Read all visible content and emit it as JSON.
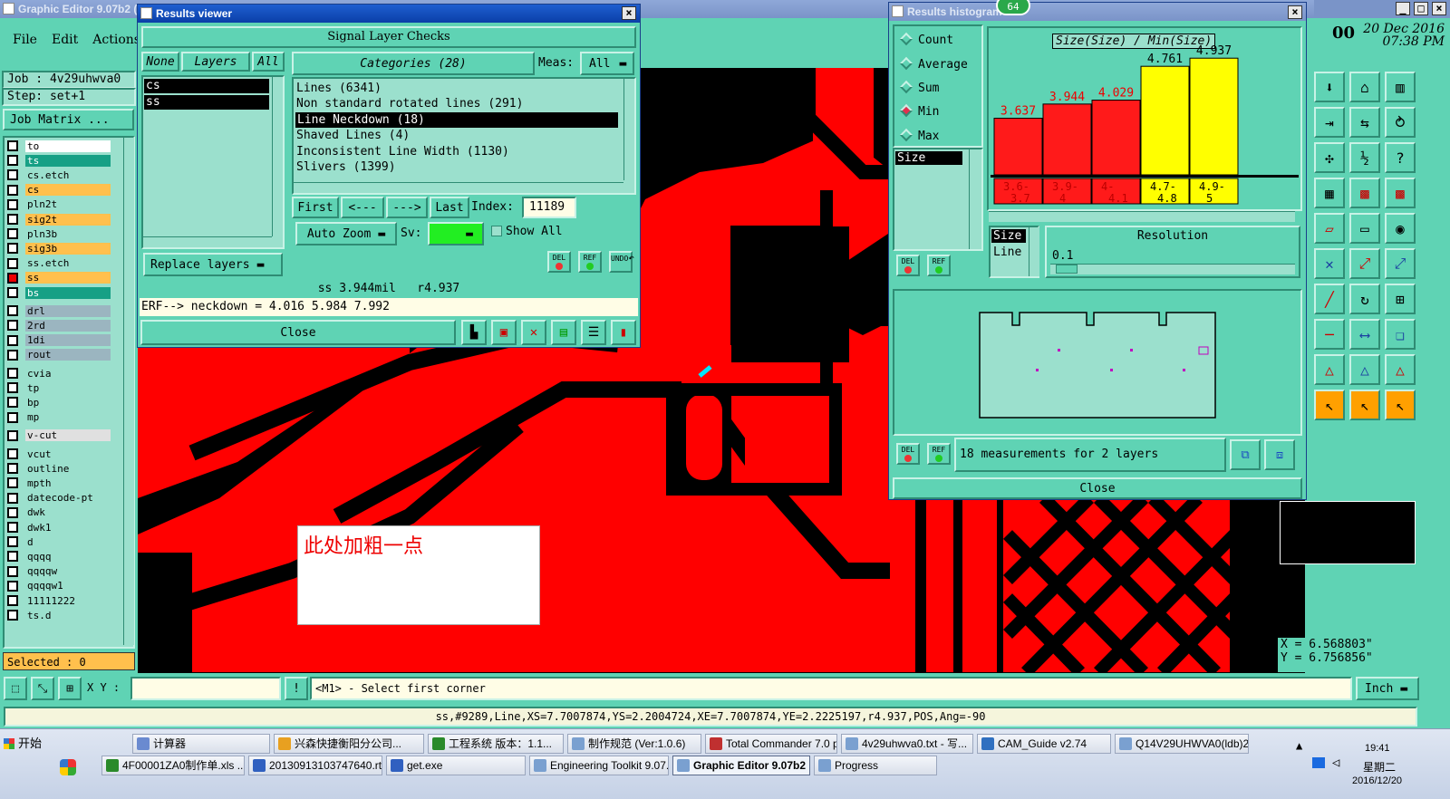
{
  "app": {
    "title": "Graphic Editor 9.07b2 (",
    "menu": [
      "File",
      "Edit",
      "Actions"
    ],
    "job_label": "Job : 4v29uhwva0",
    "step_label": "Step: set+1",
    "job_matrix_btn": "Job Matrix ...",
    "date": "20 Dec 2016",
    "time": "07:38 PM",
    "date_prefix": "00",
    "selected": "Selected : 0",
    "coord_x": "X = 6.568803\"",
    "coord_y": "Y = 6.756856\"",
    "xy_label": "X Y :",
    "prompt": "<M1> - Select first corner",
    "units": "Inch",
    "status_line": "ss,#9289,Line,XS=7.7007874,YS=2.2004724,XE=7.7007874,YE=2.2225197,r4.937,POS,Ang=-90",
    "annotation": "此处加粗一点",
    "badge": "64"
  },
  "layers": [
    {
      "name": "to",
      "color": "#ffffff"
    },
    {
      "name": "ts",
      "color": "#16a085"
    },
    {
      "name": "cs.etch",
      "color": "#9be0cd"
    },
    {
      "name": "cs",
      "color": "#ffc04d"
    },
    {
      "name": "pln2t",
      "color": "#9be0cd"
    },
    {
      "name": "sig2t",
      "color": "#ffc04d"
    },
    {
      "name": "pln3b",
      "color": "#9be0cd"
    },
    {
      "name": "sig3b",
      "color": "#ffc04d"
    },
    {
      "name": "ss.etch",
      "color": "#9be0cd"
    },
    {
      "name": "ss",
      "color": "#ffc04d"
    },
    {
      "name": "bs",
      "color": "#16a085"
    },
    {
      "name": "drl",
      "color": "#9bb5c0"
    },
    {
      "name": "2rd",
      "color": "#9bb5c0"
    },
    {
      "name": "1di",
      "color": "#9bb5c0"
    },
    {
      "name": "rout",
      "color": "#9bb5c0"
    },
    {
      "name": "cvia",
      "color": "#9be0cd"
    },
    {
      "name": "tp",
      "color": "#9be0cd"
    },
    {
      "name": "bp",
      "color": "#9be0cd"
    },
    {
      "name": "mp",
      "color": "#9be0cd"
    },
    {
      "name": "v-cut",
      "color": "#e0e0e0"
    },
    {
      "name": "vcut",
      "color": "#9be0cd"
    },
    {
      "name": "outline",
      "color": "#9be0cd"
    },
    {
      "name": "mpth",
      "color": "#9be0cd"
    },
    {
      "name": "datecode-pt",
      "color": "#9be0cd"
    },
    {
      "name": "dwk",
      "color": "#9be0cd"
    },
    {
      "name": "dwk1",
      "color": "#9be0cd"
    },
    {
      "name": "d",
      "color": "#9be0cd"
    },
    {
      "name": "qqqq",
      "color": "#9be0cd"
    },
    {
      "name": "qqqqw",
      "color": "#9be0cd"
    },
    {
      "name": "qqqqw1",
      "color": "#9be0cd"
    },
    {
      "name": "11111222",
      "color": "#9be0cd"
    },
    {
      "name": "ts.d",
      "color": "#9be0cd"
    }
  ],
  "results_viewer": {
    "title": "Results viewer",
    "header": "Signal Layer Checks",
    "none_btn": "None",
    "layers_btn": "Layers",
    "all_btn": "All",
    "categories_label": "Categories (28)",
    "meas_label": "Meas:",
    "meas_value": "All",
    "layer_items": [
      "cs",
      "ss"
    ],
    "categories": [
      "Lines (6341)",
      "Non standard rotated lines (291)",
      "Line Neckdown (18)",
      "Shaved Lines (4)",
      "Inconsistent Line Width (1130)",
      "Slivers (1399)"
    ],
    "first_btn": "First",
    "prev_btn": "<---",
    "next_btn": "--->",
    "last_btn": "Last",
    "index_label": "Index:",
    "index_value": "11189",
    "auto_zoom": "Auto Zoom",
    "sv_label": "Sv:",
    "show_all": "Show All",
    "replace_layers": "Replace layers",
    "del": "DEL",
    "ref": "REF",
    "undo": "UNDO",
    "summary": "ss 3.944mil   r4.937",
    "erf": "ERF--> neckdown = 4.016 5.984 7.992",
    "close": "Close"
  },
  "histogram": {
    "title": "Results histogram",
    "options": [
      "Count",
      "Average",
      "Sum",
      "Min",
      "Max"
    ],
    "selected_option": "Min",
    "list_item": "Size",
    "chart_title": "Size(Size) / Min(Size)",
    "resolution_label": "Resolution",
    "resolution_value": "0.1",
    "size_tab": "Size",
    "line_tab": "Line",
    "measurements": "18 measurements for 2 layers",
    "close": "Close",
    "del": "DEL",
    "ref": "REF"
  },
  "chart_data": {
    "type": "bar",
    "title": "Size(Size) / Min(Size)",
    "categories": [
      "3.6-3.7",
      "3.9-4",
      "4-4.1",
      "4.7-4.8",
      "4.9-5"
    ],
    "values": [
      3.637,
      3.944,
      4.029,
      4.761,
      4.937
    ],
    "value_labels": [
      "3.637",
      "3.944",
      "4.029",
      "4.761",
      "4.937"
    ],
    "bar_colors": [
      "#ff1a1a",
      "#ff1a1a",
      "#ff1a1a",
      "#ffff00",
      "#ffff00"
    ],
    "ylim": [
      0,
      5
    ]
  },
  "taskbar": {
    "start": "开始",
    "row1": [
      "计算器",
      "兴森快捷衡阳分公司...",
      "工程系统 版本：1.1...",
      "制作规范 (Ver:1.0.6)",
      "Total Commander 7.0 p...",
      "4v29uhwva0.txt - 写...",
      "CAM_Guide v2.74",
      "Q14V29UHWVA0(ldb)2..."
    ],
    "row2": [
      "4F00001ZA0制作单.xls ...",
      "20130913103747640.rtf...",
      "get.exe",
      "Engineering Toolkit 9.07...",
      "Graphic Editor 9.07b2 ...",
      "Progress"
    ],
    "clock": "19:41",
    "weekday": "星期二",
    "date": "2016/12/20"
  }
}
